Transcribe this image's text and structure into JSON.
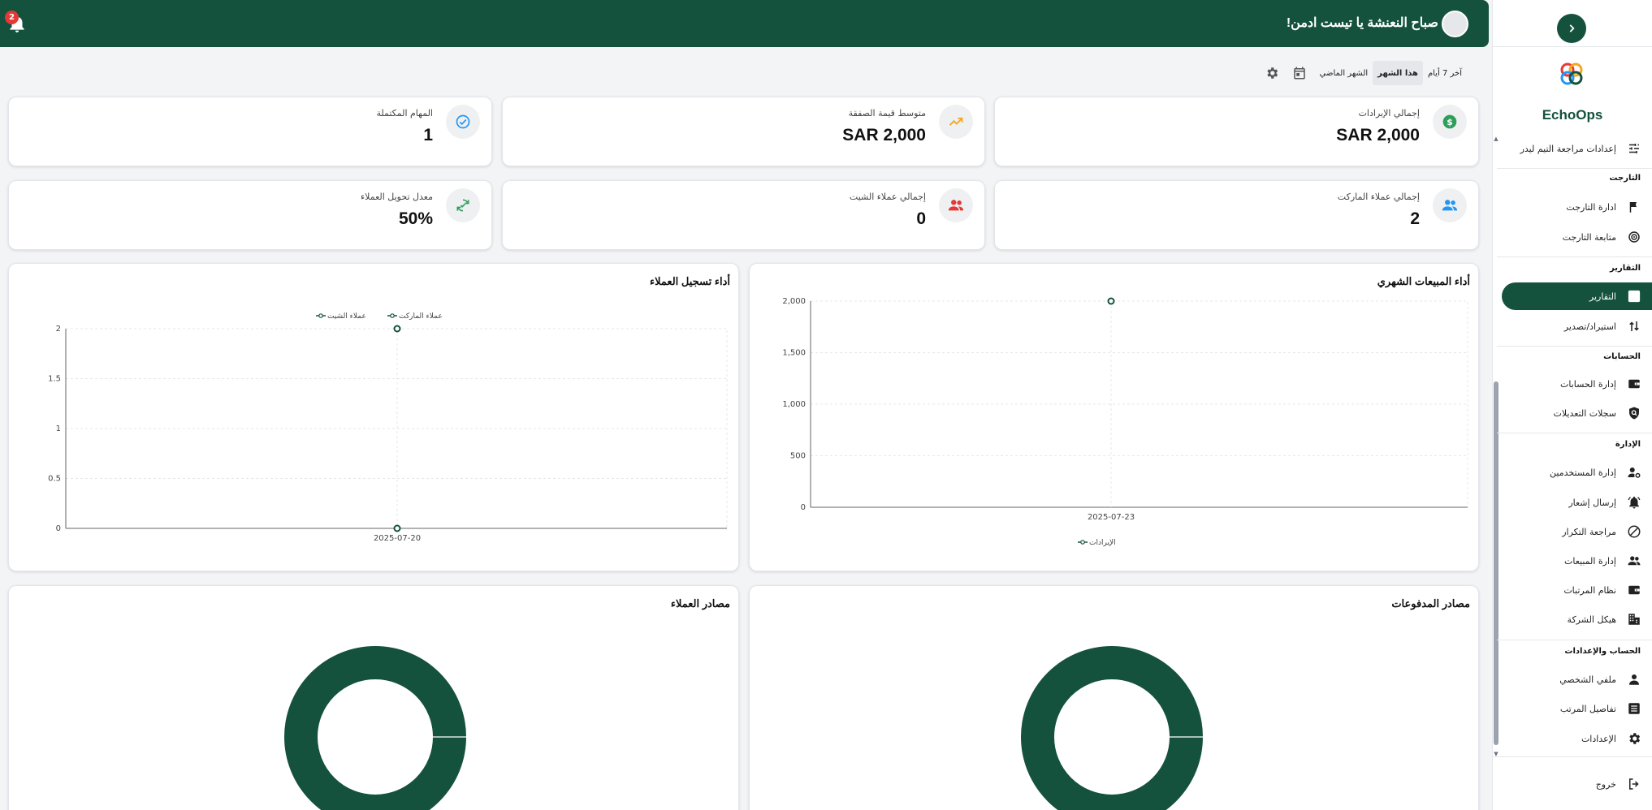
{
  "header": {
    "greeting": "صباح النعنشة يا تيست ادمن!",
    "notification_count": "2"
  },
  "filters": {
    "last7": "آخر 7 أيام",
    "this_month": "هذا الشهر",
    "last_month": "الشهر الماضي"
  },
  "stats": [
    {
      "label": "إجمالي الإيرادات",
      "value": "SAR 2,000",
      "icon": "dollar-icon",
      "color": "#2e9e5b"
    },
    {
      "label": "متوسط قيمة الصفقة",
      "value": "SAR 2,000",
      "icon": "trending-up-icon",
      "color": "#f5a623"
    },
    {
      "label": "المهام المكتملة",
      "value": "1",
      "icon": "check-circle-icon",
      "color": "#2196f3"
    },
    {
      "label": "إجمالي عملاء الماركت",
      "value": "2",
      "icon": "people-icon",
      "color": "#2196f3"
    },
    {
      "label": "إجمالي عملاء الشيت",
      "value": "0",
      "icon": "people-icon",
      "color": "#e53935"
    },
    {
      "label": "معدل تحويل العملاء",
      "value": "50%",
      "icon": "sync-icon",
      "color": "#2e9e5b"
    }
  ],
  "charts": {
    "sales_title": "أداء المبيعات الشهري",
    "clients_title": "أداء تسجيل العملاء",
    "payments_title": "مصادر المدفوعات",
    "sources_title": "مصادر العملاء"
  },
  "chart_data": [
    {
      "type": "line",
      "title": "أداء المبيعات الشهري",
      "x": [
        "2025-07-23"
      ],
      "series": [
        {
          "name": "الإيرادات",
          "values": [
            2000
          ]
        }
      ],
      "y_ticks": [
        "0",
        "500",
        "1,000",
        "1,500",
        "2,000"
      ],
      "ylim": [
        0,
        2000
      ],
      "grid": true,
      "legend": "bottom",
      "color": "#14523e"
    },
    {
      "type": "line",
      "title": "أداء تسجيل العملاء",
      "x": [
        "2025-07-20"
      ],
      "series": [
        {
          "name": "عملاء الماركت",
          "values": [
            2
          ]
        },
        {
          "name": "عملاء الشيت",
          "values": [
            0
          ]
        }
      ],
      "y_ticks": [
        "0",
        "0.5",
        "1",
        "1.5",
        "2"
      ],
      "ylim": [
        0,
        2
      ],
      "grid": true,
      "legend": "top",
      "color": "#14523e"
    },
    {
      "type": "pie",
      "title": "مصادر المدفوعات",
      "values": [
        100
      ],
      "color": "#14523e"
    },
    {
      "type": "pie",
      "title": "مصادر العملاء",
      "values": [
        100
      ],
      "color": "#14523e"
    }
  ],
  "sidebar": {
    "brand": "EchoOps",
    "items": [
      {
        "label": "إعدادات مراجعة التيم ليدر",
        "icon": "sliders-icon"
      },
      {
        "section": "التارجت"
      },
      {
        "label": "ادارة التارجت",
        "icon": "flag-icon"
      },
      {
        "label": "متابعة التارجت",
        "icon": "target-icon"
      },
      {
        "section": "التقارير"
      },
      {
        "label": "التقارير",
        "icon": "bar-chart-icon",
        "active": true
      },
      {
        "label": "استيراد/تصدير",
        "icon": "import-export-icon"
      },
      {
        "section": "الحسابات"
      },
      {
        "label": "إدارة الحسابات",
        "icon": "wallet-icon"
      },
      {
        "label": "سجلات التعديلات",
        "icon": "shield-search-icon"
      },
      {
        "section": "الإدارة"
      },
      {
        "label": "إدارة المستخدمين",
        "icon": "user-gear-icon"
      },
      {
        "label": "إرسال إشعار",
        "icon": "bell-ring-icon"
      },
      {
        "label": "مراجعة التكرار",
        "icon": "block-icon"
      },
      {
        "label": "إدارة المبيعات",
        "icon": "people-icon"
      },
      {
        "label": "نظام المرتبات",
        "icon": "wallet-icon"
      },
      {
        "label": "هيكل الشركة",
        "icon": "building-icon"
      },
      {
        "section": "الحساب والإعدادات"
      },
      {
        "label": "ملفي الشخصي",
        "icon": "person-icon"
      },
      {
        "label": "تفاصيل المرتب",
        "icon": "list-icon"
      },
      {
        "label": "الإعدادات",
        "icon": "gear-icon"
      }
    ],
    "logout": "خروج"
  }
}
